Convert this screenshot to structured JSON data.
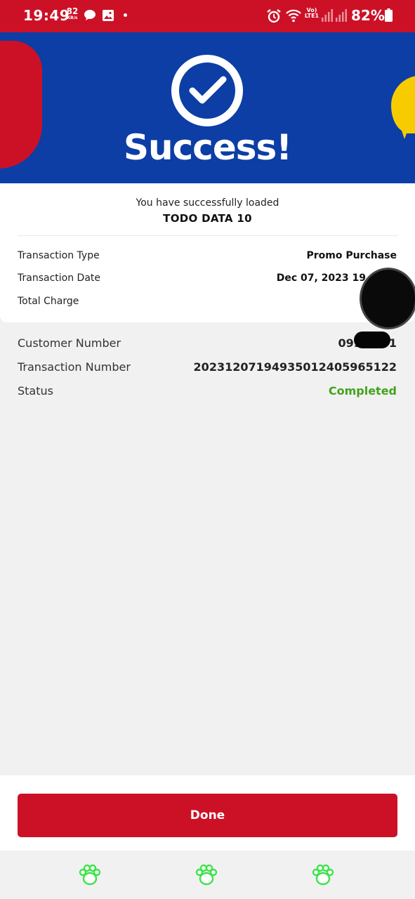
{
  "status_bar": {
    "time": "19:49",
    "speed_value": "82",
    "speed_unit": "KB/s",
    "network_vo": "Vo)",
    "network_lte": "LTE1",
    "battery": "82%"
  },
  "hero": {
    "title": "Success!"
  },
  "receipt": {
    "message": "You have successfully loaded",
    "promo_name": "TODO DATA 10",
    "rows": [
      {
        "label": "Transaction Type",
        "value": "Promo Purchase"
      },
      {
        "label": "Transaction Date",
        "value": "Dec 07, 2023  19"
      },
      {
        "label": "Total Charge",
        "value": ""
      }
    ]
  },
  "details": {
    "rows": [
      {
        "label": "Customer Number",
        "value": "09943      01"
      },
      {
        "label": "Transaction Number",
        "value": "20231207194935012405965122"
      },
      {
        "label": "Status",
        "value": "Completed"
      }
    ]
  },
  "actions": {
    "done_label": "Done"
  },
  "colors": {
    "brand_red": "#cc1127",
    "brand_blue": "#0c3ea5",
    "status_green": "#43a31b",
    "accent_yellow": "#f6cb00"
  },
  "nav_icons": [
    "paw-icon",
    "paw-icon",
    "paw-icon"
  ]
}
